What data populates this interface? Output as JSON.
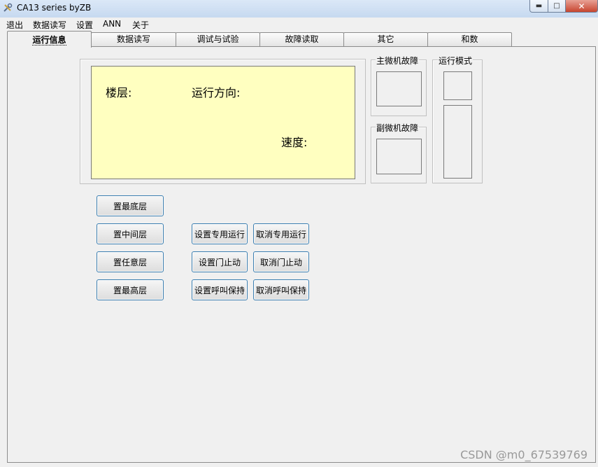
{
  "window": {
    "title": "CA13 series byZB",
    "app_icon": "tools-icon"
  },
  "menu": [
    "退出",
    "数据读写",
    "设置",
    "ANN",
    "关于"
  ],
  "tabs": [
    "运行信息",
    "数据读写",
    "调试与试验",
    "故障读取",
    "其它",
    "和数"
  ],
  "active_tab": 0,
  "display": {
    "floor_label": "楼层:",
    "direction_label": "运行方向:",
    "speed_label": "速度:",
    "background": "#ffffc0"
  },
  "groups": {
    "main_fault": "主微机故障",
    "sub_fault": "副微机故障",
    "run_mode": "运行模式"
  },
  "buttons": {
    "set_bottom": "置最底层",
    "set_middle": "置中间层",
    "set_any": "置任意层",
    "set_top": "置最高层",
    "set_dedicated": "设置专用运行",
    "cancel_dedicated": "取消专用运行",
    "set_door_stop": "设置门止动",
    "cancel_door_stop": "取消门止动",
    "set_call_hold": "设置呼叫保持",
    "cancel_call_hold": "取消呼叫保持"
  },
  "watermark": "CSDN @m0_67539769"
}
